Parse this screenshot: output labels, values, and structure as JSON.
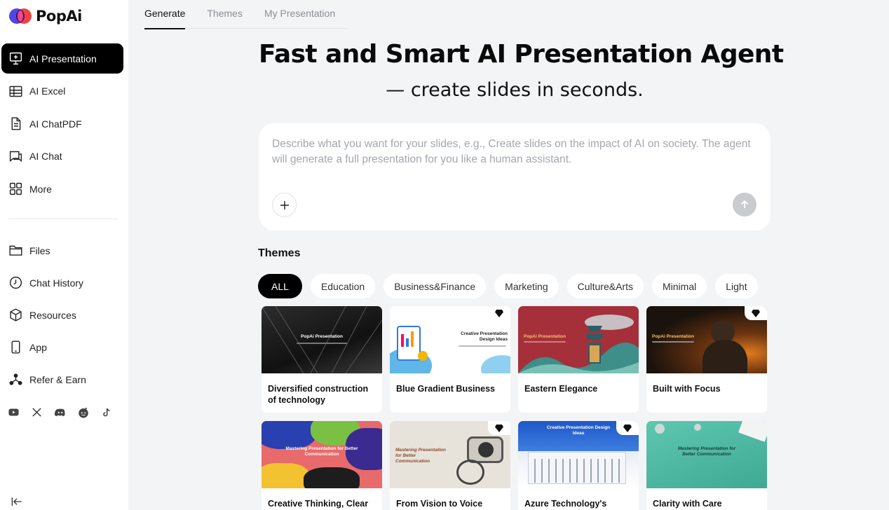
{
  "brand": {
    "name": "PopAi"
  },
  "sidebar": {
    "top_items": [
      {
        "label": "AI Presentation",
        "icon": "presentation-icon",
        "active": true
      },
      {
        "label": "AI Excel",
        "icon": "table-icon"
      },
      {
        "label": "AI ChatPDF",
        "icon": "document-icon"
      },
      {
        "label": "AI Chat",
        "icon": "chat-icon"
      },
      {
        "label": "More",
        "icon": "grid-icon"
      }
    ],
    "bottom_items": [
      {
        "label": "Files",
        "icon": "folder-icon"
      },
      {
        "label": "Chat History",
        "icon": "clock-icon"
      },
      {
        "label": "Resources",
        "icon": "cube-icon"
      },
      {
        "label": "App",
        "icon": "phone-icon"
      },
      {
        "label": "Refer & Earn",
        "icon": "share-icon"
      }
    ],
    "socials": [
      "youtube-icon",
      "x-icon",
      "discord-icon",
      "reddit-icon",
      "tiktok-icon"
    ]
  },
  "tabs": [
    {
      "label": "Generate",
      "active": true
    },
    {
      "label": "Themes"
    },
    {
      "label": "My Presentation"
    }
  ],
  "hero": {
    "title": "Fast and Smart AI Presentation Agent",
    "subtitle": "— create slides in seconds."
  },
  "prompt": {
    "placeholder": "Describe what you want for your slides, e.g., Create slides on the impact of AI on society. The agent will generate a full presentation for you like a human assistant.",
    "value": ""
  },
  "themes": {
    "heading": "Themes",
    "chips": [
      "ALL",
      "Education",
      "Business&Finance",
      "Marketing",
      "Culture&Arts",
      "Minimal",
      "Light"
    ],
    "cards": [
      {
        "title": "Diversified construction of technology",
        "premium": false,
        "thumb_text": "PopAi Presentation"
      },
      {
        "title": "Blue Gradient Business",
        "premium": true,
        "thumb_text": "Creative Presentation Design Ideas"
      },
      {
        "title": "Eastern Elegance",
        "premium": false,
        "thumb_text": "PopAi Presentation"
      },
      {
        "title": "Built with Focus",
        "premium": true,
        "thumb_text": "PopAi Presentation"
      },
      {
        "title": "Creative Thinking, Clear",
        "premium": false,
        "thumb_text": "Mastering Presentation for Better Communication"
      },
      {
        "title": "From Vision to Voice",
        "premium": true,
        "thumb_text": "Mastering Presentation for Better Communication"
      },
      {
        "title": "Azure Technology's",
        "premium": true,
        "thumb_text": "Creative Presentation Design Ideas"
      },
      {
        "title": "Clarity with Care",
        "premium": false,
        "thumb_text": "Mastering Presentation for Better Communication"
      }
    ]
  },
  "colors": {
    "accent": "#000000",
    "page_bg": "#f3f4f6",
    "panel_bg": "#ffffff",
    "muted_text": "#8a8d93"
  }
}
